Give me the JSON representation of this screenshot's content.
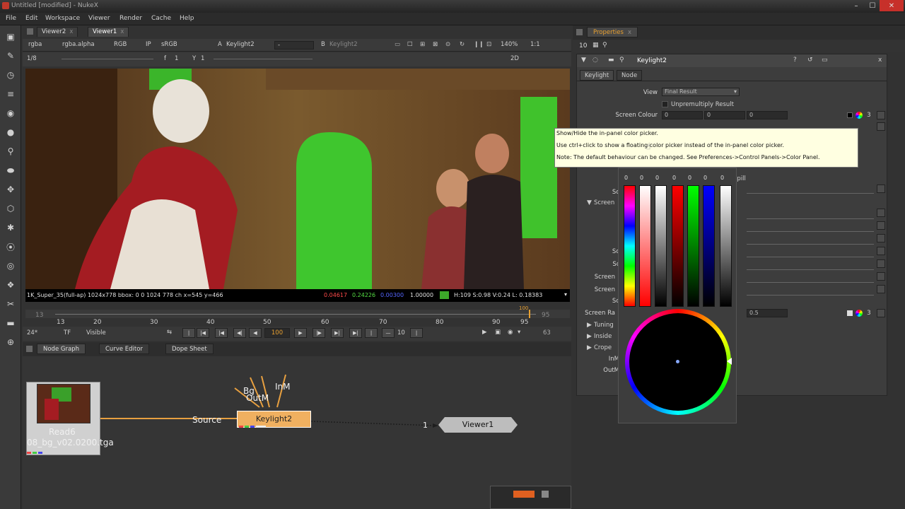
{
  "window": {
    "title": "Untitled [modified] - NukeX",
    "min": "–",
    "max": "☐",
    "close": "✕"
  },
  "menu": [
    "File",
    "Edit",
    "Workspace",
    "Viewer",
    "Render",
    "Cache",
    "Help"
  ],
  "viewer_tabs": [
    {
      "label": "Viewer2",
      "close": "x"
    },
    {
      "label": "Viewer1",
      "close": "x"
    }
  ],
  "viewer_toolbar": {
    "channels": "rgba",
    "alpha": "rgba.alpha",
    "rgb": "RGB",
    "ip": "IP",
    "lut": "sRGB",
    "a_label": "A",
    "a_input": "Keylight2",
    "a_wipe": "-",
    "b_label": "B",
    "b_input": "Keylight2",
    "zoom": "140%",
    "ratio": "1:1"
  },
  "viewer_toolbar2": {
    "frame_ratio": "1/8",
    "f_label": "f",
    "f_value": "1",
    "y_label": "Y",
    "y_value": "1",
    "mode": "2D"
  },
  "info_bar": {
    "format": "1K_Super_35(full-ap) 1024x778  bbox: 0 0 1024 778 ch  x=545 y=466",
    "r": "0.04617",
    "g": "0.24226",
    "b": "0.00300",
    "a": "1.00000",
    "hsvl": "H:109 S:0.98 V:0.24  L: 0.18383",
    "swatch": "#3ca82a"
  },
  "timeline": {
    "ticks": [
      "13",
      "20",
      "30",
      "40",
      "50",
      "60",
      "70",
      "80",
      "90",
      "95"
    ],
    "start": "13",
    "end": "95",
    "current": "100"
  },
  "playbar": {
    "fps": "24*",
    "tf": "TF",
    "visible": "Visible",
    "frame": "100",
    "step": "10",
    "end_frame": "63"
  },
  "node_tabs": [
    {
      "label": "Node Graph"
    },
    {
      "label": "Curve Editor"
    },
    {
      "label": "Dope Sheet"
    }
  ],
  "nodes": {
    "read": {
      "label": "Read6",
      "file": "08_bg_v02.0200.tga"
    },
    "keylight": {
      "label": "Keylight2",
      "inputs": {
        "source": "Source",
        "bg": "Bg",
        "outm": "OutM",
        "inm": "InM"
      }
    },
    "viewer": {
      "label": "Viewer1",
      "input": "1"
    }
  },
  "properties": {
    "header": "Properties",
    "count": "10",
    "node_name": "Keylight2",
    "tabs": [
      "Keylight",
      "Node"
    ],
    "view_label": "View",
    "view_value": "Final Result",
    "unpremultiply": "Unpremultiply Result",
    "screen_colour_label": "Screen Colour",
    "screen_colour_values": [
      "0",
      "0",
      "0"
    ],
    "spill_text": "spill",
    "screen_label_partial": "Screen",
    "rows_partial": [
      "Sc",
      "Sc",
      "Scr",
      "Screen",
      "Screen",
      "Sc"
    ],
    "screen_range_label": "Screen Ra",
    "screen_range_value": "0.5",
    "groups": [
      "Tuning",
      "Inside",
      "Crope"
    ],
    "inm_label": "InM",
    "outm_label": "OutM"
  },
  "tooltip": {
    "line1": "Show/Hide the in-panel color picker.",
    "line2": "Use ctrl+click to show a floating color picker instead of the in-panel color picker.",
    "line3": "Note: The default behaviour can be changed. See Preferences->Control Panels->Color Panel."
  },
  "picker": {
    "values": [
      "0",
      "0",
      "0",
      "0",
      "0",
      "0",
      "0"
    ]
  }
}
